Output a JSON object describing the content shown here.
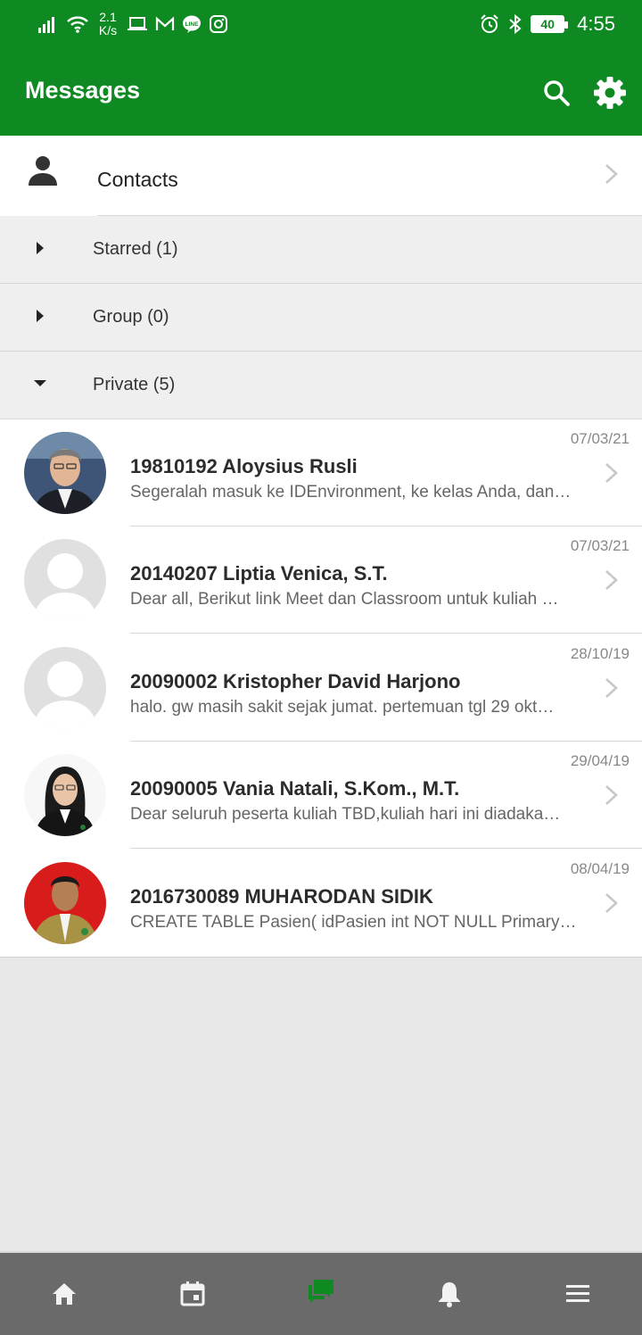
{
  "status_bar": {
    "speed_value": "2.1",
    "speed_unit": "K/s",
    "battery": "40",
    "time": "4:55"
  },
  "app_bar": {
    "title": "Messages",
    "search_icon": "search-icon",
    "settings_icon": "gear-icon"
  },
  "contacts": {
    "label": "Contacts",
    "icon": "person-icon"
  },
  "sections": [
    {
      "label": "Starred (1)",
      "expanded": false
    },
    {
      "label": "Group (0)",
      "expanded": false
    },
    {
      "label": "Private (5)",
      "expanded": true
    }
  ],
  "conversations": [
    {
      "name": "19810192 Aloysius Rusli",
      "date": "07/03/21",
      "preview": "Segeralah masuk ke IDEnvironment, ke kelas Anda, dan…"
    },
    {
      "name": "20140207 Liptia Venica, S.T.",
      "date": "07/03/21",
      "preview": "Dear all, Berikut link Meet dan Classroom untuk kuliah …"
    },
    {
      "name": "20090002 Kristopher David Harjono",
      "date": "28/10/19",
      "preview": "halo. gw masih sakit sejak jumat. pertemuan tgl 29 okt…"
    },
    {
      "name": "20090005 Vania Natali, S.Kom., M.T.",
      "date": "29/04/19",
      "preview": "Dear seluruh peserta kuliah TBD,kuliah hari ini diadaka…"
    },
    {
      "name": "2016730089 MUHARODAN SIDIK",
      "date": "08/04/19",
      "preview": "CREATE TABLE Pasien( idPasien int NOT NULL Primary…"
    }
  ],
  "bottom_nav": [
    {
      "icon": "home-icon",
      "active": false
    },
    {
      "icon": "calendar-icon",
      "active": false
    },
    {
      "icon": "messages-icon",
      "active": true
    },
    {
      "icon": "bell-icon",
      "active": false
    },
    {
      "icon": "menu-icon",
      "active": false
    }
  ],
  "colors": {
    "brand": "#0f8a23",
    "nav_background": "#6a6a6a",
    "nav_inactive_icon": "#f2f2f2"
  }
}
